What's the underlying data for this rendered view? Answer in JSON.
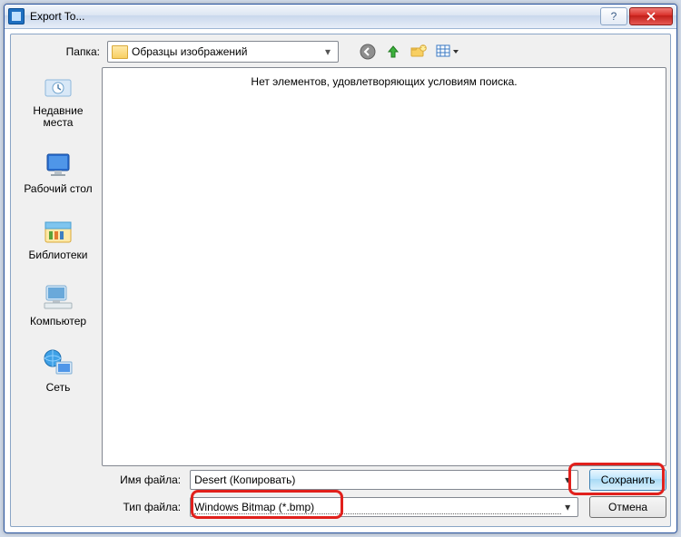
{
  "window": {
    "title": "Export To..."
  },
  "toolbar": {
    "folder_label": "Папка:",
    "folder_value": "Образцы изображений"
  },
  "sidebar": {
    "items": [
      {
        "label_line1": "Недавние",
        "label_line2": "места"
      },
      {
        "label_line1": "Рабочий стол"
      },
      {
        "label_line1": "Библиотеки"
      },
      {
        "label_line1": "Компьютер"
      },
      {
        "label_line1": "Сеть"
      }
    ]
  },
  "main": {
    "empty_message": "Нет элементов, удовлетворяющих условиям поиска."
  },
  "footer": {
    "filename_label": "Имя файла:",
    "filename_value": "Desert (Копировать)",
    "filetype_label": "Тип файла:",
    "filetype_value": "Windows Bitmap (*.bmp)",
    "save_label": "Сохранить",
    "cancel_label": "Отмена"
  }
}
